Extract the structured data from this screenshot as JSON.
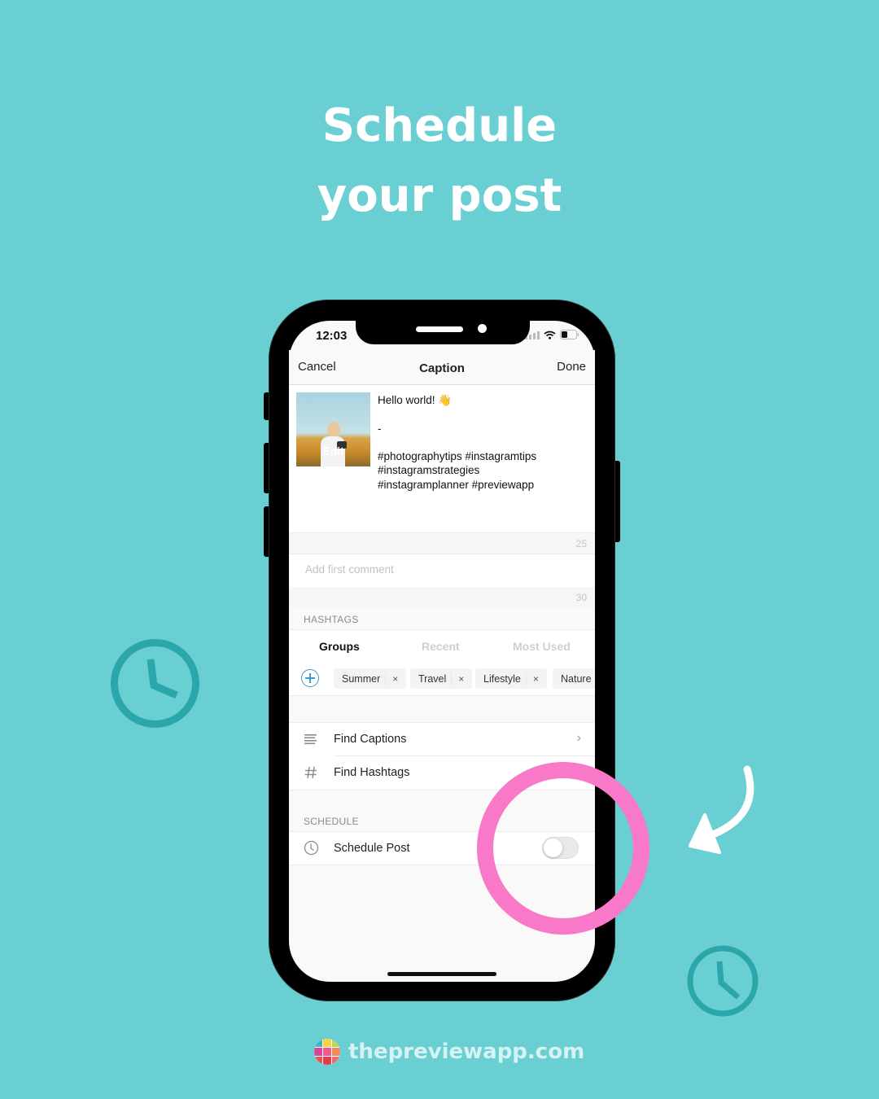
{
  "headline": {
    "line1": "Schedule",
    "line2": "your post"
  },
  "colors": {
    "background": "#6acfd2",
    "highlight_ring": "#f879c8",
    "deco_clock": "#2ba7ab",
    "accent_blue": "#3b9cc8"
  },
  "status_bar": {
    "time": "12:03",
    "icons": [
      "signal-icon",
      "wifi-icon",
      "battery-icon"
    ]
  },
  "nav": {
    "cancel_label": "Cancel",
    "title": "Caption",
    "done_label": "Done"
  },
  "post": {
    "thumbnail_label": "Edit",
    "caption": "Hello world! 👋\n\n-\n\n#photographytips #instagramtips\n#instagramstrategies\n#instagramplanner #previewapp",
    "hashtag_count": "25"
  },
  "comment": {
    "placeholder": "Add first comment",
    "value": "",
    "count": "30"
  },
  "hashtags": {
    "section_label": "HASHTAGS",
    "tabs": [
      {
        "label": "Groups",
        "active": true
      },
      {
        "label": "Recent",
        "active": false
      },
      {
        "label": "Most Used",
        "active": false
      }
    ],
    "chips": [
      {
        "label": "Summer"
      },
      {
        "label": "Travel"
      },
      {
        "label": "Lifestyle"
      },
      {
        "label": "Nature"
      }
    ],
    "remove_glyph": "×"
  },
  "tools": {
    "items": [
      {
        "label": "Find Captions",
        "icon": "lines-icon",
        "chevron": "›"
      },
      {
        "label": "Find Hashtags",
        "icon": "hash-icon"
      }
    ]
  },
  "schedule": {
    "section_label": "SCHEDULE",
    "row_label": "Schedule Post",
    "toggle_on": false
  },
  "footer": {
    "url": "thepreviewapp.com"
  }
}
